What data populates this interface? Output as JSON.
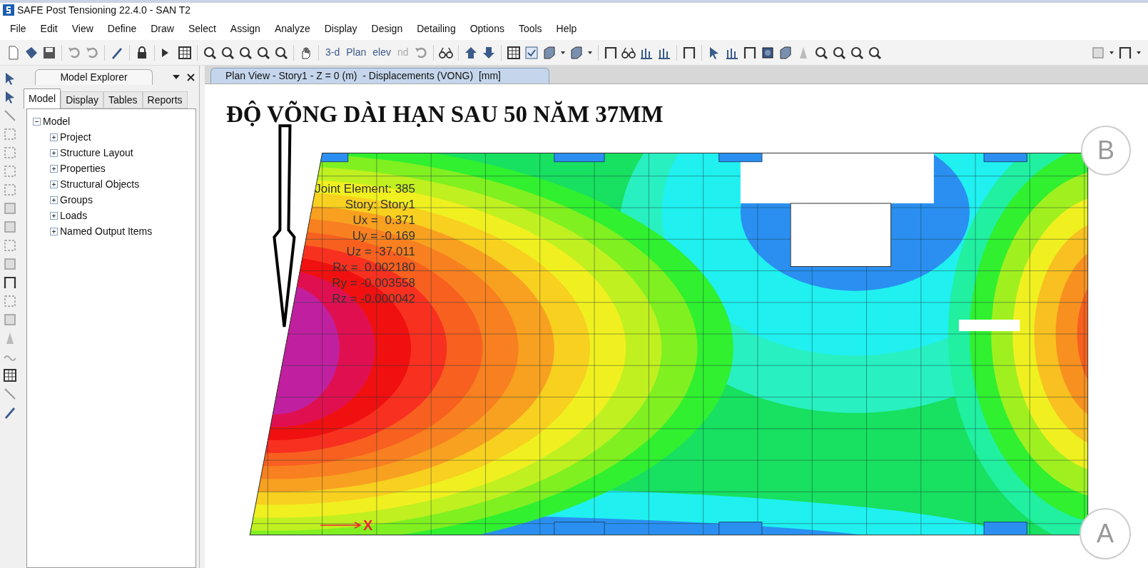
{
  "window": {
    "title": "SAFE Post Tensioning 22.4.0 - SAN T2"
  },
  "menu": [
    "File",
    "Edit",
    "View",
    "Define",
    "Draw",
    "Select",
    "Assign",
    "Analyze",
    "Display",
    "Design",
    "Detailing",
    "Options",
    "Tools",
    "Help"
  ],
  "view_buttons": [
    {
      "label": "3-d",
      "disabled": false
    },
    {
      "label": "Plan",
      "disabled": false
    },
    {
      "label": "elev",
      "disabled": false
    },
    {
      "label": "nd",
      "disabled": true
    }
  ],
  "model_explorer": {
    "title": "Model Explorer",
    "tabs": [
      {
        "label": "Model",
        "selected": true
      },
      {
        "label": "Display",
        "selected": false
      },
      {
        "label": "Tables",
        "selected": false
      },
      {
        "label": "Reports",
        "selected": false
      }
    ],
    "tree": [
      {
        "label": "Model",
        "expanded": true,
        "children": [
          {
            "label": "Project",
            "expanded": false
          },
          {
            "label": "Structure Layout",
            "expanded": false
          },
          {
            "label": "Properties",
            "expanded": false
          },
          {
            "label": "Structural Objects",
            "expanded": false
          },
          {
            "label": "Groups",
            "expanded": false
          },
          {
            "label": "Loads",
            "expanded": false
          },
          {
            "label": "Named Output Items",
            "expanded": false
          }
        ]
      }
    ]
  },
  "document_tab": {
    "title": "Plan View - Story1 - Z = 0 (m)  - Displacements (VONG)  [mm]",
    "selected": true
  },
  "plot": {
    "annotation": "ĐỘ VÕNG DÀI HẠN SAU 50 NĂM 37MM",
    "joint_info": [
      "Joint Element: 385",
      "Story: Story1",
      "Ux =  0.371",
      "Uy = -0.169",
      "Uz = -37.011",
      "Rx =  0.002180",
      "Ry = -0.003558",
      "Rz = -0.000042"
    ],
    "grid_labels": [
      "B",
      "A"
    ],
    "axis_label": "X"
  }
}
